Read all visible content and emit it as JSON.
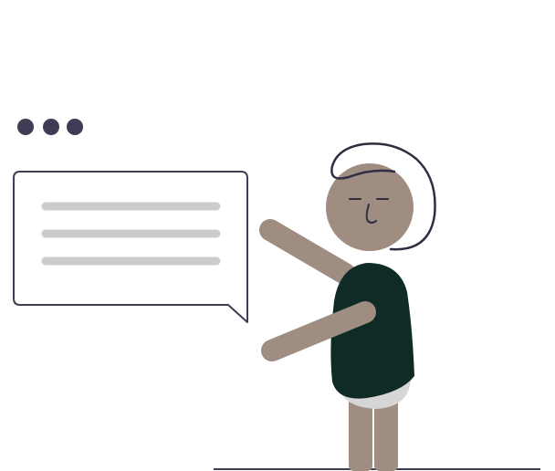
{
  "scene": {
    "description_visible_text": "",
    "colors": {
      "dots": "#3f3d56",
      "bubble_stroke": "#3f3d56",
      "bubble_fill": "#ffffff",
      "text_lines": "#cccccc",
      "skin": "#9e8d80",
      "shirt": "#0f2b26",
      "shorts": "#d6d6d6",
      "hair": "#2f2e41",
      "ground": "#3f3d56"
    },
    "icons": {
      "typing_indicator": "ellipsis-dots-icon",
      "speech_bubble": "speech-bubble-icon",
      "person": "person-illustration"
    },
    "typing_dots_count": 3,
    "bubble_text_line_count": 3
  }
}
